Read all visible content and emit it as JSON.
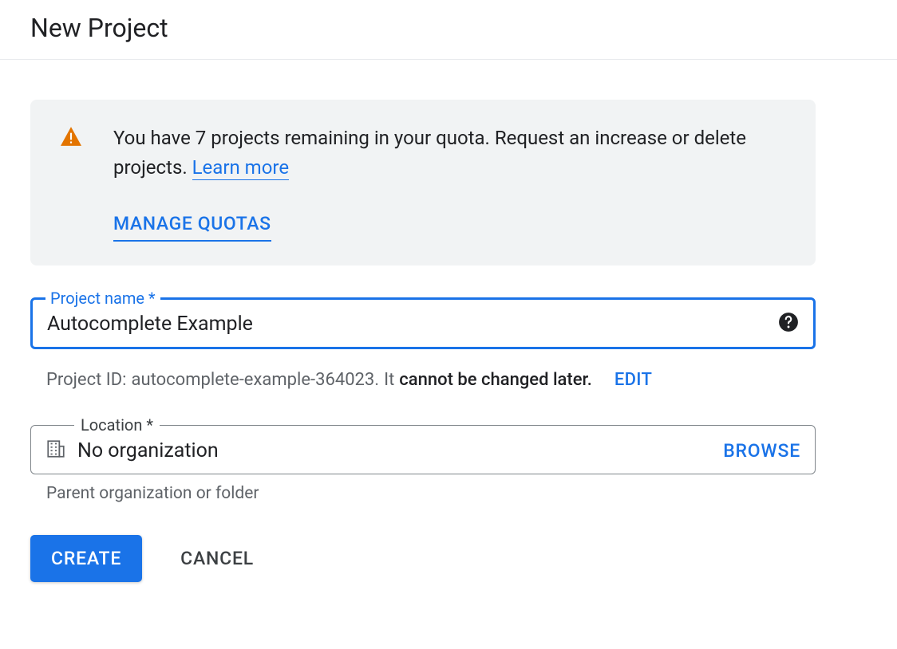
{
  "header": {
    "title": "New Project"
  },
  "notice": {
    "text_before_link": "You have 7 projects remaining in your quota. Request an increase or delete projects. ",
    "learn_more": "Learn more",
    "manage_quotas": "MANAGE QUOTAS"
  },
  "project_name": {
    "label": "Project name *",
    "value": "Autocomplete Example"
  },
  "project_id": {
    "prefix": "Project ID:",
    "value": "autocomplete-example-364023.",
    "mid": "It",
    "bold": "cannot be changed later.",
    "edit": "EDIT"
  },
  "location": {
    "label": "Location *",
    "value": "No organization",
    "browse": "BROWSE",
    "helper": "Parent organization or folder"
  },
  "actions": {
    "create": "CREATE",
    "cancel": "CANCEL"
  }
}
